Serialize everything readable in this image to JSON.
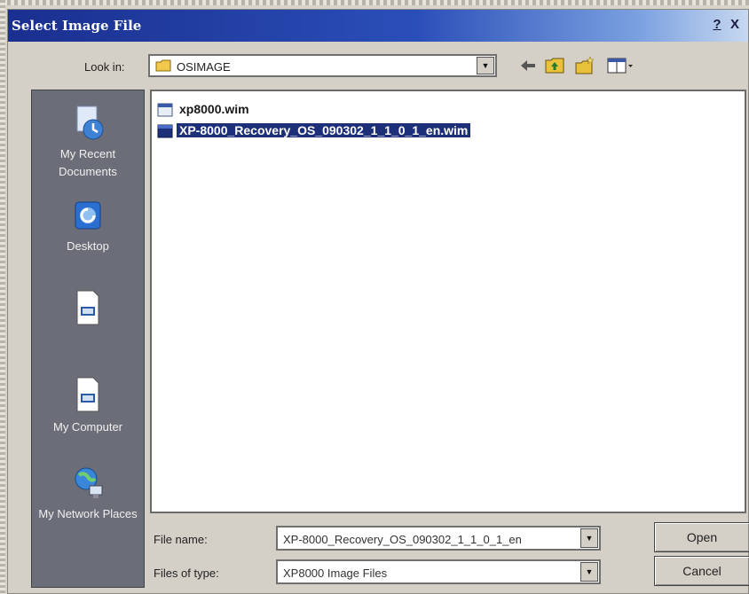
{
  "window": {
    "title": "Select Image File",
    "help_label": "?",
    "close_label": "X"
  },
  "toolbar": {
    "lookin_label": "Look in:",
    "lookin_value": "OSIMAGE",
    "back_icon": "back-arrow-icon",
    "up_icon": "up-one-level-icon",
    "newfolder_icon": "new-folder-icon",
    "views_icon": "views-menu-icon"
  },
  "places": [
    {
      "label": "My Recent Documents",
      "icon": "recent-documents-icon"
    },
    {
      "label": "Desktop",
      "icon": "desktop-icon"
    },
    {
      "label": "",
      "icon": "document-icon"
    },
    {
      "label": "My Computer",
      "icon": "my-computer-icon"
    },
    {
      "label": "My Network Places",
      "icon": "network-places-icon"
    }
  ],
  "files": [
    {
      "name": "xp8000.wim",
      "selected": false
    },
    {
      "name": "XP-8000_Recovery_OS_090302_1_1_0_1_en.wim",
      "selected": true
    }
  ],
  "footer": {
    "filename_label": "File name:",
    "filename_value": "XP-8000_Recovery_OS_090302_1_1_0_1_en",
    "filetype_label": "Files of type:",
    "filetype_value": "XP8000 Image Files",
    "open_label": "Open",
    "cancel_label": "Cancel"
  },
  "colors": {
    "title_bar": "#1a2f8f",
    "selection": "#1c2f78",
    "places_bar": "#6b6e78"
  }
}
